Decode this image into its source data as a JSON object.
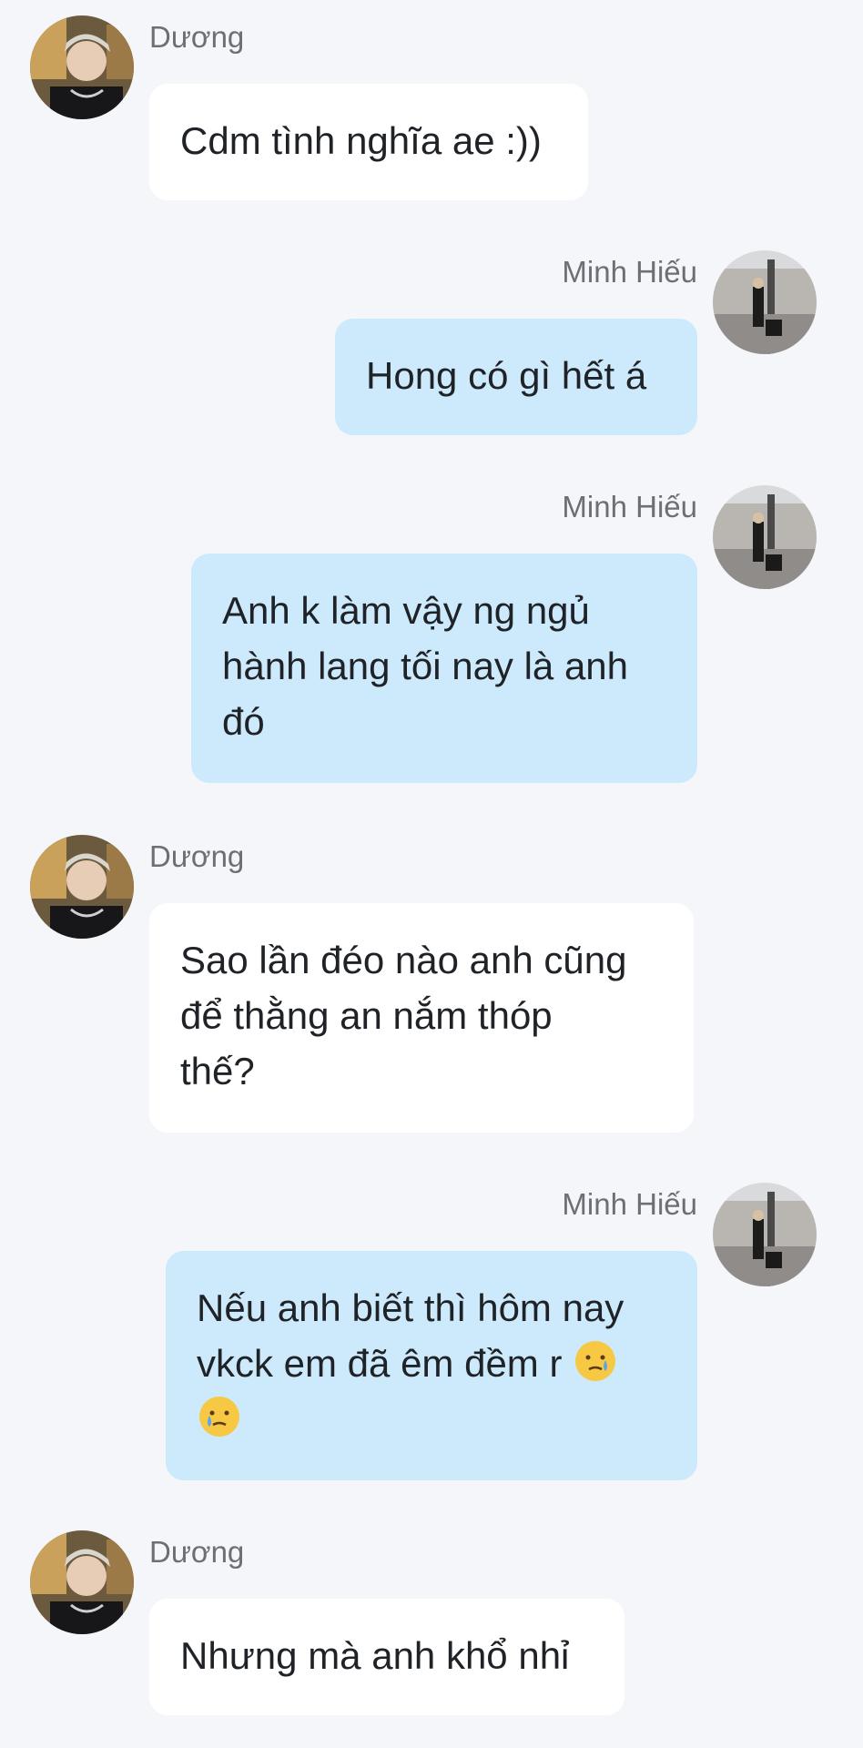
{
  "messages": [
    {
      "sender": "Dương",
      "direction": "incoming",
      "text": "Cdm tình nghĩa ae :))"
    },
    {
      "sender": "Minh Hiếu",
      "direction": "outgoing",
      "text": "Hong có gì hết á"
    },
    {
      "sender": "Minh Hiếu",
      "direction": "outgoing",
      "lines": [
        "Anh k làm vậy ng ngủ",
        "hành lang tối nay là anh",
        "đó"
      ]
    },
    {
      "sender": "Dương",
      "direction": "incoming",
      "lines": [
        "Sao lần đéo nào anh cũng",
        "để thằng an nắm thóp",
        "thế?"
      ]
    },
    {
      "sender": "Minh Hiếu",
      "direction": "outgoing",
      "lines": [
        "Nếu anh biết thì hôm nay",
        "vkck em đã êm đềm r"
      ],
      "emoji": "crying-face-icon"
    },
    {
      "sender": "Dương",
      "direction": "incoming",
      "text": "Nhưng mà anh khổ nhỉ"
    }
  ],
  "colors": {
    "background": "#f4f6f9",
    "incoming_bubble": "#ffffff",
    "outgoing_bubble": "#cdeafc",
    "sender_text": "#6b6f76",
    "message_text": "#1f2226"
  }
}
